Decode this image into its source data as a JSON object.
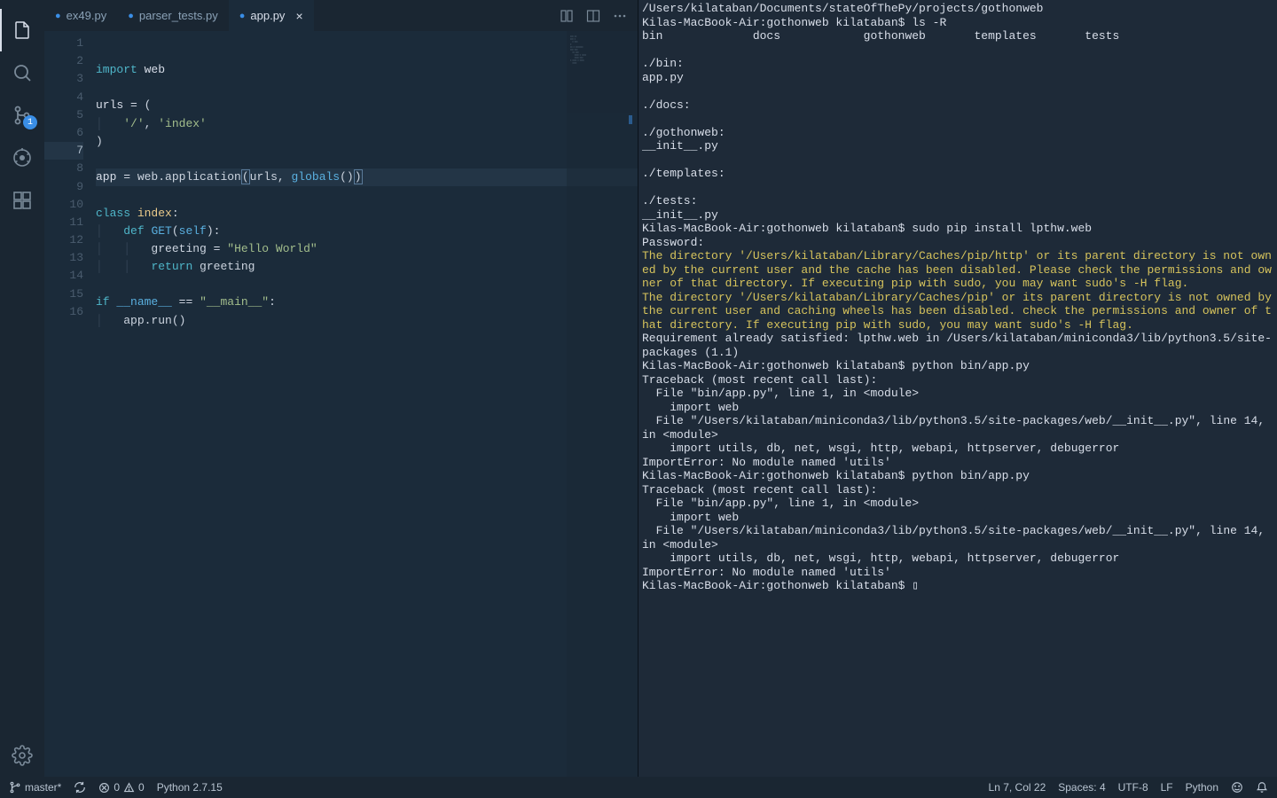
{
  "tabs": [
    {
      "icon": "●",
      "label": "ex49.py",
      "active": false,
      "close": false
    },
    {
      "icon": "●",
      "label": "parser_tests.py",
      "active": false,
      "close": false
    },
    {
      "icon": "●",
      "label": "app.py",
      "active": true,
      "close": true
    }
  ],
  "sourceControlBadge": "1",
  "code": {
    "lines": [
      {
        "n": "1",
        "html": "<span class='kw'>import</span> <span class='var'>web</span>"
      },
      {
        "n": "2",
        "html": ""
      },
      {
        "n": "3",
        "html": "<span class='var'>urls</span> <span class='op'>=</span> ("
      },
      {
        "n": "4",
        "html": "<span class='guide'>│</span>   <span class='str'>'/'</span>, <span class='str'>'index'</span>"
      },
      {
        "n": "5",
        "html": ")"
      },
      {
        "n": "6",
        "html": ""
      },
      {
        "n": "7",
        "current": true,
        "html": "<span class='var'>app</span> <span class='op'>=</span> web.application<span class='paren-hl'>(</span>urls, <span class='builtin'>globals</span>()<span class='paren-hl'>)</span>"
      },
      {
        "n": "8",
        "html": ""
      },
      {
        "n": "9",
        "html": "<span class='kw'>class</span> <span class='cls'>index</span>:"
      },
      {
        "n": "10",
        "html": "<span class='guide'>│</span>   <span class='kw'>def</span> <span class='fn'>GET</span>(<span class='builtin'>self</span>):"
      },
      {
        "n": "11",
        "html": "<span class='guide'>│</span>   <span class='guide'>│</span>   greeting <span class='op'>=</span> <span class='str'>\"Hello World\"</span>"
      },
      {
        "n": "12",
        "html": "<span class='guide'>│</span>   <span class='guide'>│</span>   <span class='kw'>return</span> greeting"
      },
      {
        "n": "13",
        "html": ""
      },
      {
        "n": "14",
        "html": "<span class='kw'>if</span> <span class='builtin'>__name__</span> <span class='op'>==</span> <span class='str'>\"__main__\"</span>:"
      },
      {
        "n": "15",
        "html": "<span class='guide'>│</span>   app.run()"
      },
      {
        "n": "16",
        "html": ""
      }
    ]
  },
  "terminal": [
    {
      "c": "t-white",
      "t": "/Users/kilataban/Documents/stateOfThePy/projects/gothonweb"
    },
    {
      "c": "t-white",
      "t": "Kilas-MacBook-Air:gothonweb kilataban$ ls -R"
    },
    {
      "c": "t-white",
      "t": "bin             docs            gothonweb       templates       tests"
    },
    {
      "c": "t-white",
      "t": ""
    },
    {
      "c": "t-white",
      "t": "./bin:"
    },
    {
      "c": "t-white",
      "t": "app.py"
    },
    {
      "c": "t-white",
      "t": ""
    },
    {
      "c": "t-white",
      "t": "./docs:"
    },
    {
      "c": "t-white",
      "t": ""
    },
    {
      "c": "t-white",
      "t": "./gothonweb:"
    },
    {
      "c": "t-white",
      "t": "__init__.py"
    },
    {
      "c": "t-white",
      "t": ""
    },
    {
      "c": "t-white",
      "t": "./templates:"
    },
    {
      "c": "t-white",
      "t": ""
    },
    {
      "c": "t-white",
      "t": "./tests:"
    },
    {
      "c": "t-white",
      "t": "__init__.py"
    },
    {
      "c": "t-white",
      "t": "Kilas-MacBook-Air:gothonweb kilataban$ sudo pip install lpthw.web"
    },
    {
      "c": "t-white",
      "t": "Password:"
    },
    {
      "c": "t-yellow",
      "t": "The directory '/Users/kilataban/Library/Caches/pip/http' or its parent directory is not owned by the current user and the cache has been disabled. Please check the permissions and owner of that directory. If executing pip with sudo, you may want sudo's -H flag."
    },
    {
      "c": "t-yellow",
      "t": "The directory '/Users/kilataban/Library/Caches/pip' or its parent directory is not owned by the current user and caching wheels has been disabled. check the permissions and owner of that directory. If executing pip with sudo, you may want sudo's -H flag."
    },
    {
      "c": "t-white",
      "t": "Requirement already satisfied: lpthw.web in /Users/kilataban/miniconda3/lib/python3.5/site-packages (1.1)"
    },
    {
      "c": "t-white",
      "t": "Kilas-MacBook-Air:gothonweb kilataban$ python bin/app.py"
    },
    {
      "c": "t-white",
      "t": "Traceback (most recent call last):"
    },
    {
      "c": "t-white",
      "t": "  File \"bin/app.py\", line 1, in <module>"
    },
    {
      "c": "t-white",
      "t": "    import web"
    },
    {
      "c": "t-white",
      "t": "  File \"/Users/kilataban/miniconda3/lib/python3.5/site-packages/web/__init__.py\", line 14, in <module>"
    },
    {
      "c": "t-white",
      "t": "    import utils, db, net, wsgi, http, webapi, httpserver, debugerror"
    },
    {
      "c": "t-white",
      "t": "ImportError: No module named 'utils'"
    },
    {
      "c": "t-white",
      "t": "Kilas-MacBook-Air:gothonweb kilataban$ python bin/app.py"
    },
    {
      "c": "t-white",
      "t": "Traceback (most recent call last):"
    },
    {
      "c": "t-white",
      "t": "  File \"bin/app.py\", line 1, in <module>"
    },
    {
      "c": "t-white",
      "t": "    import web"
    },
    {
      "c": "t-white",
      "t": "  File \"/Users/kilataban/miniconda3/lib/python3.5/site-packages/web/__init__.py\", line 14, in <module>"
    },
    {
      "c": "t-white",
      "t": "    import utils, db, net, wsgi, http, webapi, httpserver, debugerror"
    },
    {
      "c": "t-white",
      "t": "ImportError: No module named 'utils'"
    },
    {
      "c": "t-white",
      "t": "Kilas-MacBook-Air:gothonweb kilataban$ ▯"
    }
  ],
  "status": {
    "branch": "master*",
    "errors": "0",
    "warnings": "0",
    "python": "Python 2.7.15",
    "cursor": "Ln 7, Col 22",
    "spaces": "Spaces: 4",
    "encoding": "UTF-8",
    "eol": "LF",
    "lang": "Python"
  }
}
